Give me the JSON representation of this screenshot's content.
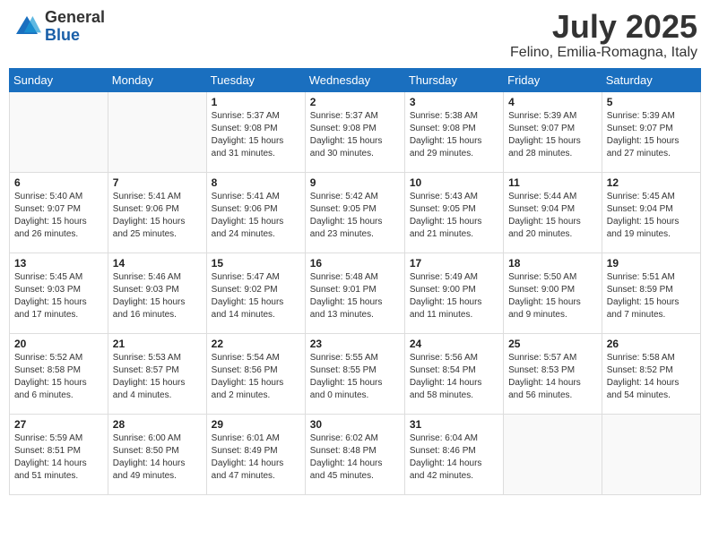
{
  "logo": {
    "general": "General",
    "blue": "Blue"
  },
  "title": "July 2025",
  "location": "Felino, Emilia-Romagna, Italy",
  "weekdays": [
    "Sunday",
    "Monday",
    "Tuesday",
    "Wednesday",
    "Thursday",
    "Friday",
    "Saturday"
  ],
  "weeks": [
    [
      {
        "day": "",
        "info": ""
      },
      {
        "day": "",
        "info": ""
      },
      {
        "day": "1",
        "info": "Sunrise: 5:37 AM\nSunset: 9:08 PM\nDaylight: 15 hours\nand 31 minutes."
      },
      {
        "day": "2",
        "info": "Sunrise: 5:37 AM\nSunset: 9:08 PM\nDaylight: 15 hours\nand 30 minutes."
      },
      {
        "day": "3",
        "info": "Sunrise: 5:38 AM\nSunset: 9:08 PM\nDaylight: 15 hours\nand 29 minutes."
      },
      {
        "day": "4",
        "info": "Sunrise: 5:39 AM\nSunset: 9:07 PM\nDaylight: 15 hours\nand 28 minutes."
      },
      {
        "day": "5",
        "info": "Sunrise: 5:39 AM\nSunset: 9:07 PM\nDaylight: 15 hours\nand 27 minutes."
      }
    ],
    [
      {
        "day": "6",
        "info": "Sunrise: 5:40 AM\nSunset: 9:07 PM\nDaylight: 15 hours\nand 26 minutes."
      },
      {
        "day": "7",
        "info": "Sunrise: 5:41 AM\nSunset: 9:06 PM\nDaylight: 15 hours\nand 25 minutes."
      },
      {
        "day": "8",
        "info": "Sunrise: 5:41 AM\nSunset: 9:06 PM\nDaylight: 15 hours\nand 24 minutes."
      },
      {
        "day": "9",
        "info": "Sunrise: 5:42 AM\nSunset: 9:05 PM\nDaylight: 15 hours\nand 23 minutes."
      },
      {
        "day": "10",
        "info": "Sunrise: 5:43 AM\nSunset: 9:05 PM\nDaylight: 15 hours\nand 21 minutes."
      },
      {
        "day": "11",
        "info": "Sunrise: 5:44 AM\nSunset: 9:04 PM\nDaylight: 15 hours\nand 20 minutes."
      },
      {
        "day": "12",
        "info": "Sunrise: 5:45 AM\nSunset: 9:04 PM\nDaylight: 15 hours\nand 19 minutes."
      }
    ],
    [
      {
        "day": "13",
        "info": "Sunrise: 5:45 AM\nSunset: 9:03 PM\nDaylight: 15 hours\nand 17 minutes."
      },
      {
        "day": "14",
        "info": "Sunrise: 5:46 AM\nSunset: 9:03 PM\nDaylight: 15 hours\nand 16 minutes."
      },
      {
        "day": "15",
        "info": "Sunrise: 5:47 AM\nSunset: 9:02 PM\nDaylight: 15 hours\nand 14 minutes."
      },
      {
        "day": "16",
        "info": "Sunrise: 5:48 AM\nSunset: 9:01 PM\nDaylight: 15 hours\nand 13 minutes."
      },
      {
        "day": "17",
        "info": "Sunrise: 5:49 AM\nSunset: 9:00 PM\nDaylight: 15 hours\nand 11 minutes."
      },
      {
        "day": "18",
        "info": "Sunrise: 5:50 AM\nSunset: 9:00 PM\nDaylight: 15 hours\nand 9 minutes."
      },
      {
        "day": "19",
        "info": "Sunrise: 5:51 AM\nSunset: 8:59 PM\nDaylight: 15 hours\nand 7 minutes."
      }
    ],
    [
      {
        "day": "20",
        "info": "Sunrise: 5:52 AM\nSunset: 8:58 PM\nDaylight: 15 hours\nand 6 minutes."
      },
      {
        "day": "21",
        "info": "Sunrise: 5:53 AM\nSunset: 8:57 PM\nDaylight: 15 hours\nand 4 minutes."
      },
      {
        "day": "22",
        "info": "Sunrise: 5:54 AM\nSunset: 8:56 PM\nDaylight: 15 hours\nand 2 minutes."
      },
      {
        "day": "23",
        "info": "Sunrise: 5:55 AM\nSunset: 8:55 PM\nDaylight: 15 hours\nand 0 minutes."
      },
      {
        "day": "24",
        "info": "Sunrise: 5:56 AM\nSunset: 8:54 PM\nDaylight: 14 hours\nand 58 minutes."
      },
      {
        "day": "25",
        "info": "Sunrise: 5:57 AM\nSunset: 8:53 PM\nDaylight: 14 hours\nand 56 minutes."
      },
      {
        "day": "26",
        "info": "Sunrise: 5:58 AM\nSunset: 8:52 PM\nDaylight: 14 hours\nand 54 minutes."
      }
    ],
    [
      {
        "day": "27",
        "info": "Sunrise: 5:59 AM\nSunset: 8:51 PM\nDaylight: 14 hours\nand 51 minutes."
      },
      {
        "day": "28",
        "info": "Sunrise: 6:00 AM\nSunset: 8:50 PM\nDaylight: 14 hours\nand 49 minutes."
      },
      {
        "day": "29",
        "info": "Sunrise: 6:01 AM\nSunset: 8:49 PM\nDaylight: 14 hours\nand 47 minutes."
      },
      {
        "day": "30",
        "info": "Sunrise: 6:02 AM\nSunset: 8:48 PM\nDaylight: 14 hours\nand 45 minutes."
      },
      {
        "day": "31",
        "info": "Sunrise: 6:04 AM\nSunset: 8:46 PM\nDaylight: 14 hours\nand 42 minutes."
      },
      {
        "day": "",
        "info": ""
      },
      {
        "day": "",
        "info": ""
      }
    ]
  ]
}
